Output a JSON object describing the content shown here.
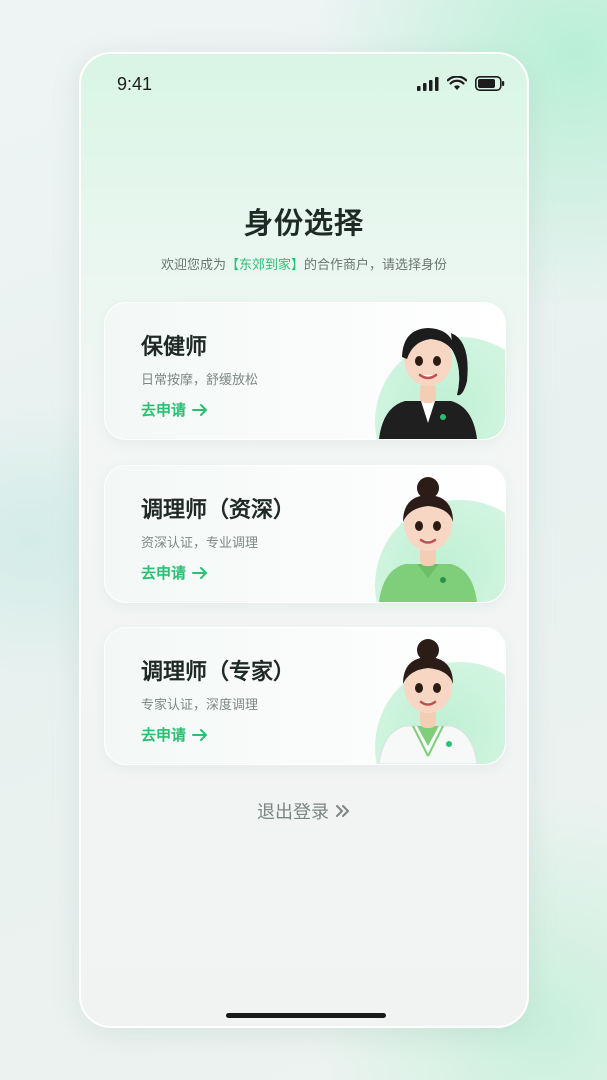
{
  "status_bar": {
    "time": "9:41"
  },
  "page": {
    "title": "身份选择",
    "subtitle_prefix": "欢迎您成为",
    "subtitle_brand": "【东郊到家】",
    "subtitle_suffix": "的合作商户，请选择身份"
  },
  "roles": [
    {
      "name": "保健师",
      "desc": "日常按摩，舒缓放松",
      "apply_label": "去申请",
      "avatar": "therapist-avatar-black-uniform"
    },
    {
      "name": "调理师（资深）",
      "desc": "资深认证，专业调理",
      "apply_label": "去申请",
      "avatar": "therapist-avatar-green-polo"
    },
    {
      "name": "调理师（专家）",
      "desc": "专家认证，深度调理",
      "apply_label": "去申请",
      "avatar": "therapist-avatar-white-coat"
    }
  ],
  "logout": {
    "label": "退出登录"
  },
  "colors": {
    "accent": "#2bbf73",
    "title": "#1e2a26",
    "muted": "#7e8784"
  }
}
